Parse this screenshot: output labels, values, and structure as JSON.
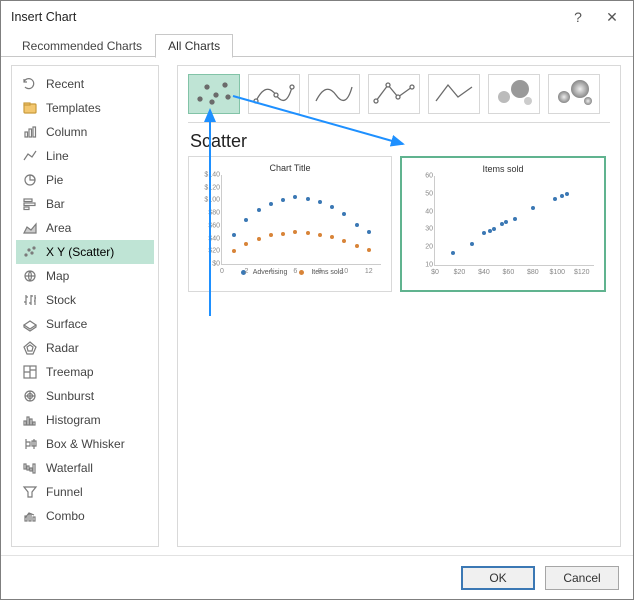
{
  "titlebar": {
    "title": "Insert Chart",
    "help": "?",
    "close": "✕"
  },
  "tabs": {
    "recommended": "Recommended Charts",
    "all": "All Charts"
  },
  "sidebar": {
    "items": [
      {
        "label": "Recent",
        "icon": "recent-icon"
      },
      {
        "label": "Templates",
        "icon": "templates-icon"
      },
      {
        "label": "Column",
        "icon": "column-icon"
      },
      {
        "label": "Line",
        "icon": "line-icon"
      },
      {
        "label": "Pie",
        "icon": "pie-icon"
      },
      {
        "label": "Bar",
        "icon": "bar-icon"
      },
      {
        "label": "Area",
        "icon": "area-icon"
      },
      {
        "label": "X Y (Scatter)",
        "icon": "scatter-icon"
      },
      {
        "label": "Map",
        "icon": "map-icon"
      },
      {
        "label": "Stock",
        "icon": "stock-icon"
      },
      {
        "label": "Surface",
        "icon": "surface-icon"
      },
      {
        "label": "Radar",
        "icon": "radar-icon"
      },
      {
        "label": "Treemap",
        "icon": "treemap-icon"
      },
      {
        "label": "Sunburst",
        "icon": "sunburst-icon"
      },
      {
        "label": "Histogram",
        "icon": "histogram-icon"
      },
      {
        "label": "Box & Whisker",
        "icon": "box-whisker-icon"
      },
      {
        "label": "Waterfall",
        "icon": "waterfall-icon"
      },
      {
        "label": "Funnel",
        "icon": "funnel-icon"
      },
      {
        "label": "Combo",
        "icon": "combo-icon"
      }
    ],
    "selected_index": 7
  },
  "main": {
    "section_title": "Scatter",
    "subtypes": [
      {
        "name": "scatter-plain",
        "selected": true
      },
      {
        "name": "scatter-smooth-markers"
      },
      {
        "name": "scatter-smooth"
      },
      {
        "name": "scatter-straight-markers"
      },
      {
        "name": "scatter-straight"
      },
      {
        "name": "bubble"
      },
      {
        "name": "bubble-3d"
      }
    ],
    "previews": {
      "left": {
        "title": "Chart Title",
        "legend": [
          "Advertising",
          "Items sold"
        ]
      },
      "right": {
        "title": "Items sold"
      }
    }
  },
  "footer": {
    "ok": "OK",
    "cancel": "Cancel"
  },
  "chart_data": [
    {
      "type": "scatter",
      "title": "Chart Title",
      "xlabel": "",
      "ylabel": "",
      "xlim": [
        0,
        13
      ],
      "ylim": [
        0,
        140
      ],
      "yticks": [
        0,
        20,
        40,
        60,
        80,
        100,
        120,
        140
      ],
      "yticklabels": [
        "$0",
        "$20",
        "$40",
        "$60",
        "$80",
        "$100",
        "$120",
        "$140"
      ],
      "xticks": [
        0,
        2,
        4,
        6,
        8,
        10,
        12
      ],
      "series": [
        {
          "name": "Advertising",
          "color": "#3b78b4",
          "points": [
            [
              1,
              45
            ],
            [
              2,
              70
            ],
            [
              3,
              85
            ],
            [
              4,
              95
            ],
            [
              5,
              100
            ],
            [
              6,
              105
            ],
            [
              7,
              102
            ],
            [
              8,
              98
            ],
            [
              9,
              90
            ],
            [
              10,
              78
            ],
            [
              11,
              62
            ],
            [
              12,
              50
            ]
          ]
        },
        {
          "name": "Items sold",
          "color": "#d88438",
          "points": [
            [
              1,
              20
            ],
            [
              2,
              32
            ],
            [
              3,
              40
            ],
            [
              4,
              45
            ],
            [
              5,
              48
            ],
            [
              6,
              50
            ],
            [
              7,
              49
            ],
            [
              8,
              46
            ],
            [
              9,
              42
            ],
            [
              10,
              36
            ],
            [
              11,
              28
            ],
            [
              12,
              22
            ]
          ]
        }
      ]
    },
    {
      "type": "scatter",
      "title": "Items sold",
      "xlabel": "",
      "ylabel": "",
      "xlim": [
        0,
        130
      ],
      "ylim": [
        10,
        60
      ],
      "yticks": [
        10,
        20,
        30,
        40,
        50,
        60
      ],
      "xticks": [
        0,
        20,
        40,
        60,
        80,
        100,
        120
      ],
      "xticklabels": [
        "$0",
        "$20",
        "$40",
        "$60",
        "$80",
        "$100",
        "$120"
      ],
      "series": [
        {
          "name": "Items sold",
          "color": "#3b78b4",
          "points": [
            [
              15,
              17
            ],
            [
              30,
              22
            ],
            [
              40,
              28
            ],
            [
              45,
              29
            ],
            [
              48,
              30
            ],
            [
              55,
              33
            ],
            [
              58,
              34
            ],
            [
              65,
              36
            ],
            [
              80,
              42
            ],
            [
              98,
              47
            ],
            [
              104,
              49
            ],
            [
              108,
              50
            ]
          ]
        }
      ]
    }
  ]
}
